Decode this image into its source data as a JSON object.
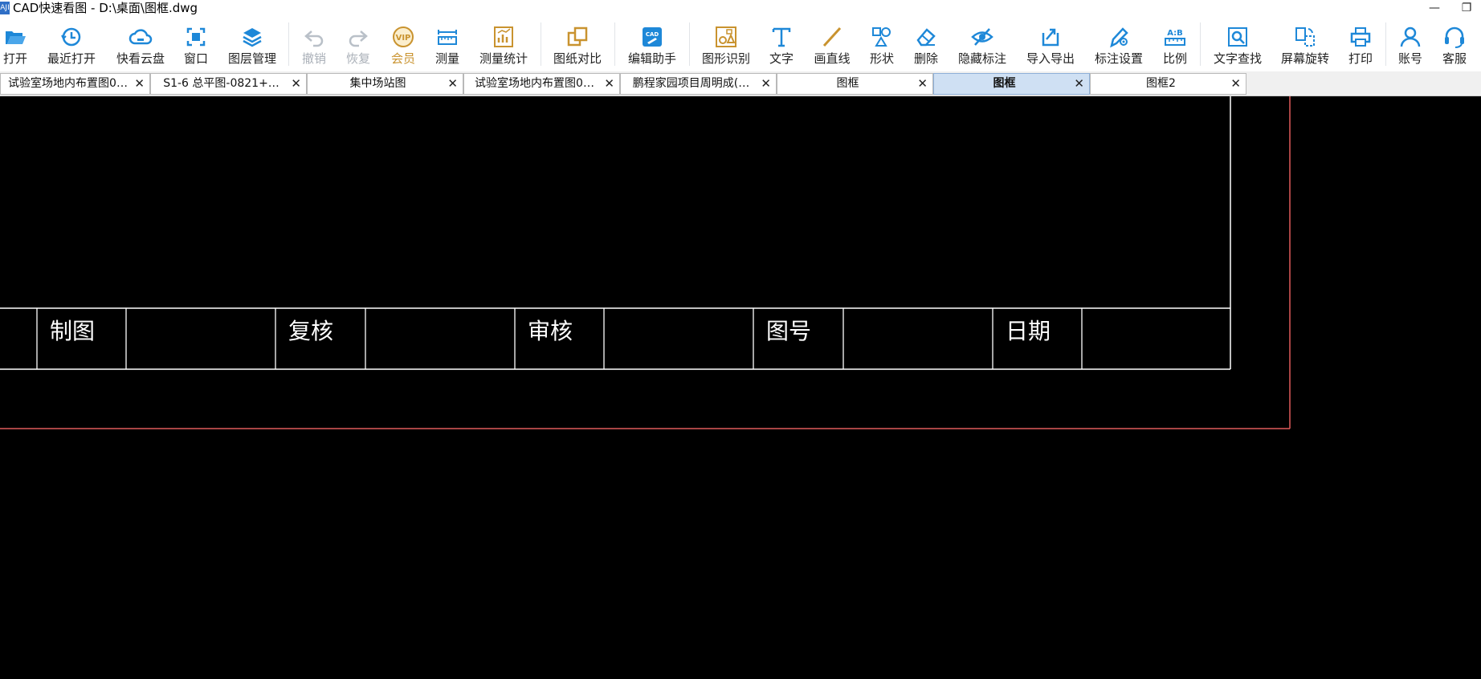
{
  "window": {
    "logo": "AJI",
    "title": "CAD快速看图 - D:\\桌面\\图框.dwg",
    "minimize": "—",
    "restore": "❐"
  },
  "toolbar": {
    "items": [
      {
        "label": "打开",
        "icon": "folder-open-icon"
      },
      {
        "label": "最近打开",
        "icon": "clock-history-icon"
      },
      {
        "label": "快看云盘",
        "icon": "cloud-icon"
      },
      {
        "label": "窗口",
        "icon": "window-frame-icon"
      },
      {
        "label": "图层管理",
        "icon": "layers-icon"
      },
      {
        "label": "撤销",
        "icon": "undo-icon"
      },
      {
        "label": "恢复",
        "icon": "redo-icon"
      },
      {
        "label": "会员",
        "icon": "vip-badge-icon"
      },
      {
        "label": "测量",
        "icon": "ruler-icon"
      },
      {
        "label": "测量统计",
        "icon": "measure-chart-icon"
      },
      {
        "label": "图纸对比",
        "icon": "compare-icon"
      },
      {
        "label": "编辑助手",
        "icon": "cad-edit-icon"
      },
      {
        "label": "图形识别",
        "icon": "shape-recognize-icon"
      },
      {
        "label": "文字",
        "icon": "text-icon"
      },
      {
        "label": "画直线",
        "icon": "line-icon"
      },
      {
        "label": "形状",
        "icon": "shapes-icon"
      },
      {
        "label": "删除",
        "icon": "eraser-icon"
      },
      {
        "label": "隐藏标注",
        "icon": "eye-hidden-icon"
      },
      {
        "label": "导入导出",
        "icon": "import-export-icon"
      },
      {
        "label": "标注设置",
        "icon": "annotation-settings-icon"
      },
      {
        "label": "比例",
        "icon": "scale-icon"
      },
      {
        "label": "文字查找",
        "icon": "text-search-icon"
      },
      {
        "label": "屏幕旋转",
        "icon": "rotate-screen-icon"
      },
      {
        "label": "打印",
        "icon": "printer-icon"
      },
      {
        "label": "账号",
        "icon": "user-icon"
      },
      {
        "label": "客服",
        "icon": "headset-icon"
      }
    ]
  },
  "tabs": [
    {
      "label": "试验室场地内布置图0…",
      "close": "✕",
      "active": false
    },
    {
      "label": "S1-6 总平图-0821+…",
      "close": "✕",
      "active": false
    },
    {
      "label": "集中场站图",
      "close": "✕",
      "active": false
    },
    {
      "label": "试验室场地内布置图0…",
      "close": "✕",
      "active": false
    },
    {
      "label": "鹏程家园项目周明成(…",
      "close": "✕",
      "active": false
    },
    {
      "label": "图框",
      "close": "✕",
      "active": false
    },
    {
      "label": "图框",
      "close": "✕",
      "active": true
    },
    {
      "label": "图框2",
      "close": "✕",
      "active": false
    }
  ],
  "drawing": {
    "title_block": {
      "cells": [
        "制图",
        "复核",
        "审核",
        "图号",
        "日期"
      ]
    },
    "colors": {
      "background": "#000000",
      "frame_line": "#ffffff",
      "border_line": "#e05a5a"
    }
  },
  "colors": {
    "accent": "#1e88d8",
    "vip": "#c9932f",
    "active_tab": "#cfe0f3"
  }
}
